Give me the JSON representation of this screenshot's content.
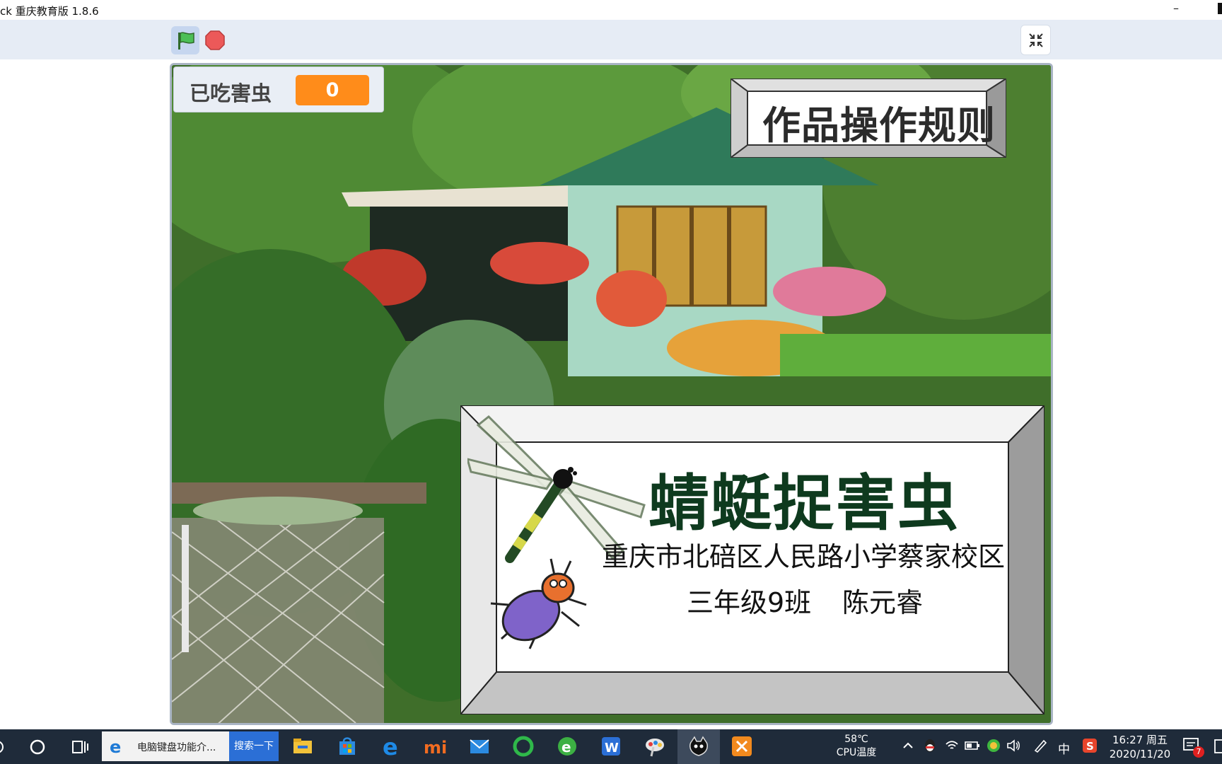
{
  "window": {
    "title": "ck 重庆教育版 1.8.6",
    "minimize_glyph": "–"
  },
  "toolbar": {
    "green_flag_icon": "flag-icon",
    "stop_icon": "stop-icon",
    "exit_fullscreen_icon": "exit-fullscreen-icon"
  },
  "stage": {
    "variable": {
      "label": "已吃害虫",
      "value": "0"
    },
    "rules_button": "作品操作规则",
    "title_panel": {
      "game_title": "蜻蜓捉害虫",
      "school": "重庆市北碚区人民路小学蔡家校区",
      "class": "三年级9班",
      "author": "陈元睿"
    }
  },
  "taskbar": {
    "browser_tab": "电脑键盘功能介...",
    "search_button": "搜索一下",
    "cpu_temp": "58℃",
    "cpu_label": "CPU温度",
    "ime": "中",
    "time": "16:27 周五",
    "date": "2020/11/20",
    "notification_count": "7",
    "accent": "#2b6fd6"
  }
}
